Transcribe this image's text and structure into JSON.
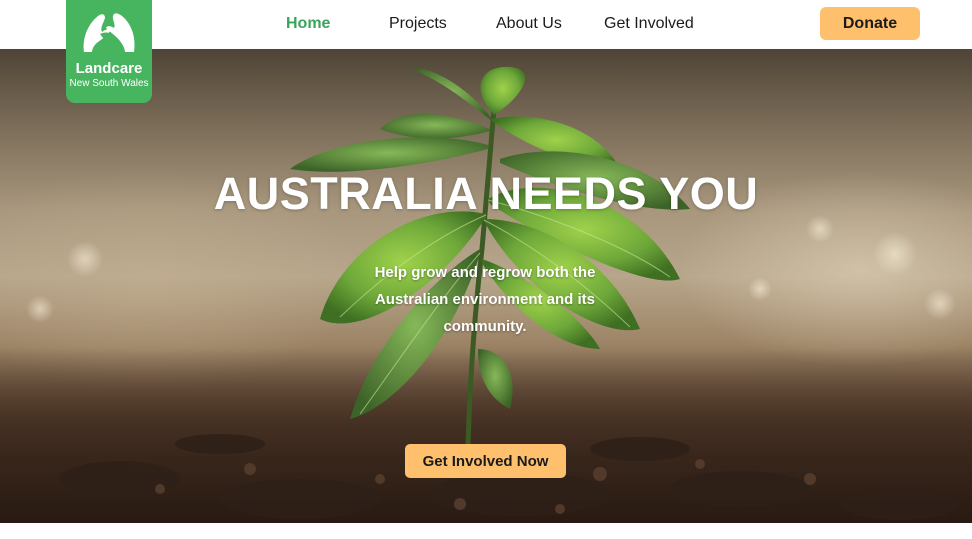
{
  "logo": {
    "name": "Landcare",
    "subtitle": "New South Wales",
    "icon": "hands-australia-icon"
  },
  "nav": {
    "items": [
      {
        "label": "Home",
        "active": true
      },
      {
        "label": "Projects",
        "active": false
      },
      {
        "label": "About Us",
        "active": false
      },
      {
        "label": "Get Involved",
        "active": false
      }
    ],
    "donate_label": "Donate"
  },
  "hero": {
    "title": "AUSTRALIA NEEDS YOU",
    "subtitle": "Help grow and regrow both the Australian environment and its community.",
    "cta_label": "Get Involved Now",
    "image": "seedling-in-soil"
  },
  "colors": {
    "brand_green": "#47b560",
    "active_nav": "#3aa55a",
    "button_orange": "#fec06d"
  }
}
